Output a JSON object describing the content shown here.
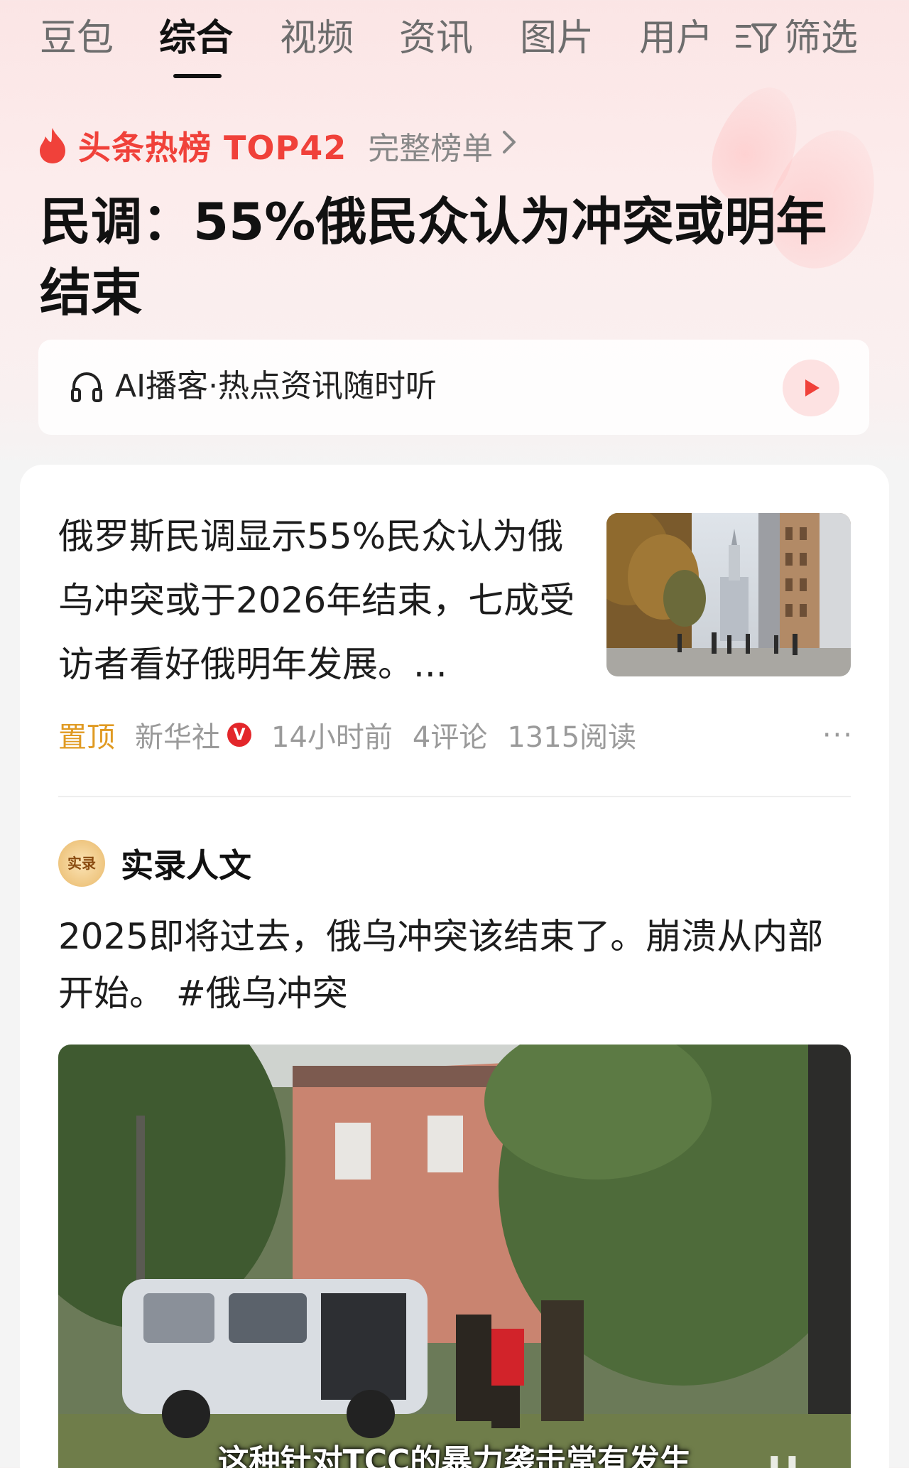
{
  "tabs": [
    {
      "label": "豆包",
      "active": false
    },
    {
      "label": "综合",
      "active": true
    },
    {
      "label": "视频",
      "active": false
    },
    {
      "label": "资讯",
      "active": false
    },
    {
      "label": "图片",
      "active": false
    },
    {
      "label": "用户",
      "active": false
    }
  ],
  "filter": {
    "label": "筛选",
    "icon": "filter-icon"
  },
  "hotlist": {
    "label": "头条热榜 TOP42",
    "full_list": "完整榜单",
    "icon": "flame-icon",
    "accent_color": "#f0413a"
  },
  "headline": "民调：55%俄民众认为冲突或明年结束",
  "ai_podcast": {
    "text": "AI播客·热点资讯随时听",
    "icon": "headphone-icon",
    "play_icon": "play-icon"
  },
  "article": {
    "title": "俄罗斯民调显示55%民众认为俄乌冲突或于2026年结束，七成受访者看好俄明年发展。...",
    "pinned": "置顶",
    "source": "新华社",
    "verified": "V",
    "time": "14小时前",
    "comments": "4评论",
    "reads": "1315阅读",
    "more": "···"
  },
  "post": {
    "author": "实录人文",
    "avatar_text": "实录",
    "text": "2025即将过去，俄乌冲突该结束了。崩溃从内部开始。 #俄乌冲突",
    "video_subtitle": "这种针对TCC的暴力袭击常有发生"
  }
}
